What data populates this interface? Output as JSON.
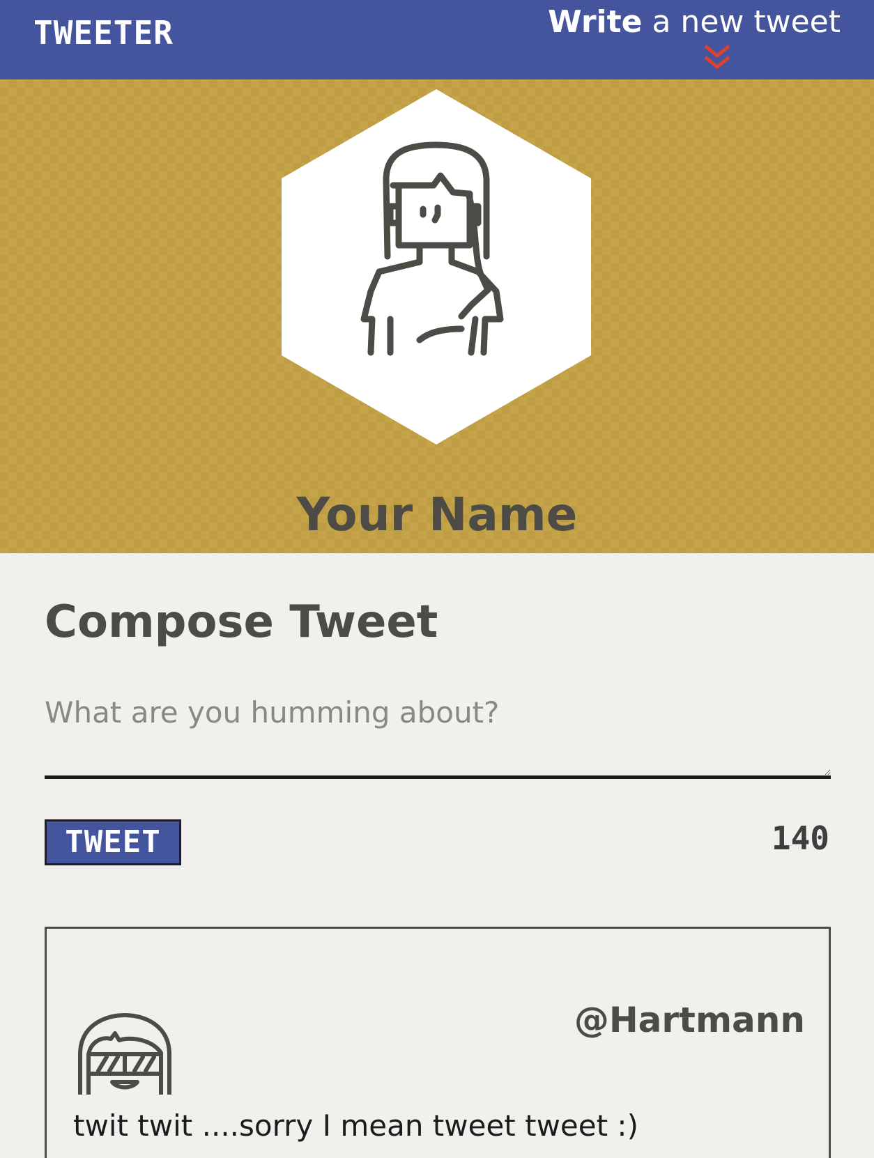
{
  "nav": {
    "brand": "TWEETER",
    "compose_bold": "Write",
    "compose_rest": " a new tweet",
    "chevron_icon": "double-chevron-down-icon",
    "bar_color": "#45559d",
    "chevron_color": "#d9432f"
  },
  "header": {
    "profile_name": "Your Name",
    "avatar_icon": "female-user-avatar-icon",
    "background_color": "#c5a348"
  },
  "composer": {
    "title": "Compose Tweet",
    "placeholder": "What are you humming about?",
    "value": "",
    "button_label": "TWEET",
    "counter": "140"
  },
  "tweets": [
    {
      "handle": "@Hartmann",
      "text": "twit twit ....sorry I mean tweet tweet :)",
      "avatar_icon": "user-with-sunglasses-avatar-icon"
    }
  ]
}
